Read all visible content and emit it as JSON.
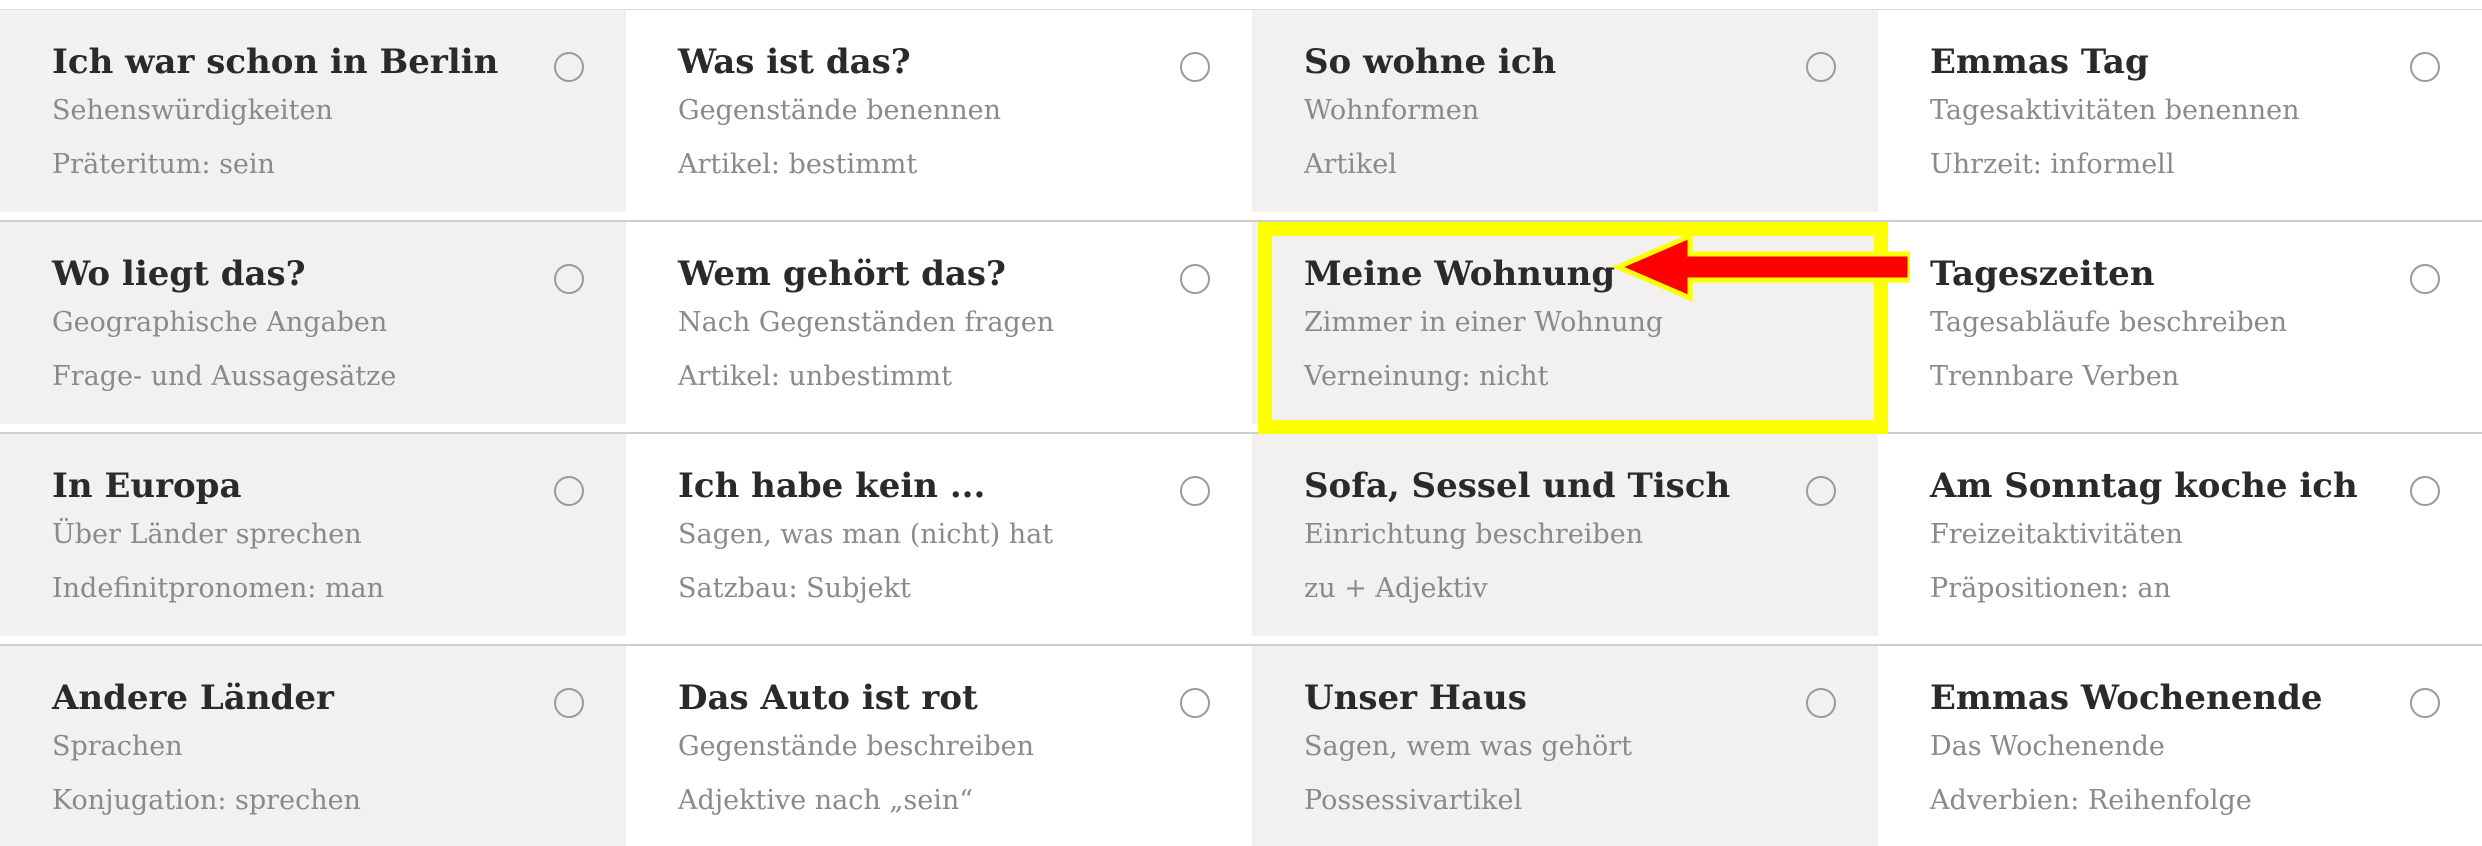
{
  "rows": [
    [
      {
        "title": "Ich war schon in Berlin",
        "line1": "Sehenswürdigkeiten",
        "line2": "Präteritum: sein"
      },
      {
        "title": "Was ist das?",
        "line1": "Gegenstände benennen",
        "line2": "Artikel: bestimmt"
      },
      {
        "title": "So wohne ich",
        "line1": "Wohnformen",
        "line2": "Artikel"
      },
      {
        "title": "Emmas Tag",
        "line1": "Tagesaktivitäten benennen",
        "line2": "Uhrzeit: informell"
      }
    ],
    [
      {
        "title": "Wo liegt das?",
        "line1": "Geographische Angaben",
        "line2": "Frage- und Aussagesätze"
      },
      {
        "title": "Wem gehört das?",
        "line1": "Nach Gegenständen fragen",
        "line2": "Artikel: unbestimmt"
      },
      {
        "title": "Meine Wohnung",
        "line1": "Zimmer in einer Wohnung",
        "line2": "Verneinung: nicht"
      },
      {
        "title": "Tageszeiten",
        "line1": "Tagesabläufe beschreiben",
        "line2": "Trennbare Verben"
      }
    ],
    [
      {
        "title": "In Europa",
        "line1": "Über Länder sprechen",
        "line2": "Indefinitpronomen: man"
      },
      {
        "title": "Ich habe kein ...",
        "line1": "Sagen, was man (nicht) hat",
        "line2": "Satzbau: Subjekt"
      },
      {
        "title": "Sofa, Sessel und Tisch",
        "line1": "Einrichtung beschreiben",
        "line2": "zu + Adjektiv"
      },
      {
        "title": "Am Sonntag koche ich",
        "line1": "Freizeitaktivitäten",
        "line2": "Präpositionen: an"
      }
    ],
    [
      {
        "title": "Andere Länder",
        "line1": "Sprachen",
        "line2": "Konjugation: sprechen"
      },
      {
        "title": "Das Auto ist rot",
        "line1": "Gegenstände beschreiben",
        "line2": "Adjektive nach „sein“"
      },
      {
        "title": "Unser Haus",
        "line1": "Sagen, wem was gehört",
        "line2": "Possessivartikel"
      },
      {
        "title": "Emmas Wochenende",
        "line1": "Das Wochenende",
        "line2": "Adverbien: Reihenfolge"
      }
    ]
  ],
  "colors": {
    "grey_cell": "#f2f1ef",
    "highlight": "#ffff00",
    "arrow": "#ff0000"
  }
}
